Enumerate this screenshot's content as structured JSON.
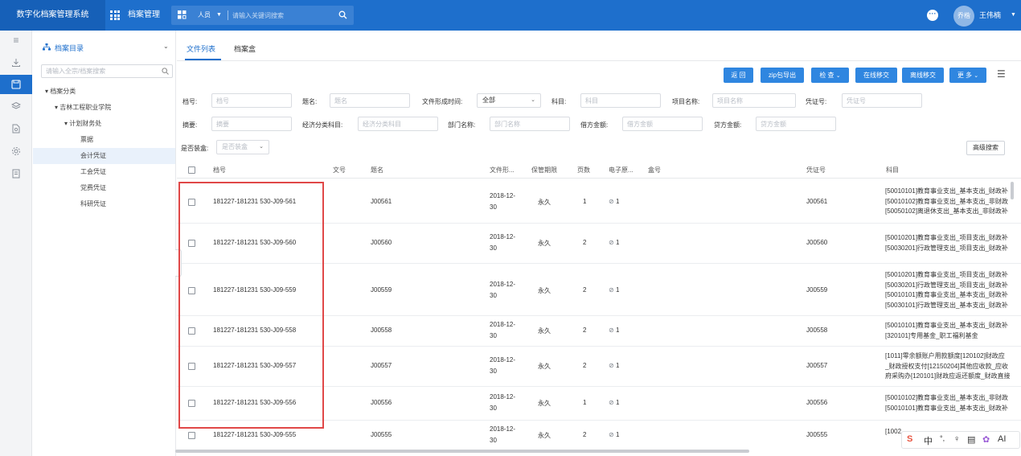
{
  "topbar": {
    "app_title": "数字化档案管理系统",
    "menu_archive": "档案管理",
    "search_scope": "人员",
    "search_placeholder": "请输入关键词搜索",
    "avatar_text": "乔楷",
    "username": "王伟楠"
  },
  "tree": {
    "title": "档案目录",
    "search_placeholder": "请输入全宗/档案搜索",
    "nodes": [
      {
        "label": "档案分类",
        "level": 0
      },
      {
        "label": "吉林工程职业学院",
        "level": 1
      },
      {
        "label": "计划财务处",
        "level": 2
      },
      {
        "label": "票据",
        "level": 3
      },
      {
        "label": "会计凭证",
        "level": 3,
        "selected": true
      },
      {
        "label": "工会凭证",
        "level": 3
      },
      {
        "label": "党费凭证",
        "level": 3
      },
      {
        "label": "科研凭证",
        "level": 3
      }
    ]
  },
  "tabs": [
    "文件列表",
    "档案盒"
  ],
  "toolbar": {
    "return": "返 回",
    "zip_export": "zip包导出",
    "check": "检 查",
    "online_transfer": "在线移交",
    "offline_transfer": "离线移交",
    "more": "更 多"
  },
  "filters": {
    "doc_no": {
      "label": "档号:",
      "placeholder": "档号"
    },
    "title": {
      "label": "题名:",
      "placeholder": "题名"
    },
    "form_time": {
      "label": "文件形成时间:",
      "value": "全部"
    },
    "subject": {
      "label": "科目:",
      "placeholder": "科目"
    },
    "project": {
      "label": "项目名称:",
      "placeholder": "项目名称"
    },
    "voucher": {
      "label": "凭证号:",
      "placeholder": "凭证号"
    },
    "summary": {
      "label": "摘要:",
      "placeholder": "摘要"
    },
    "econ": {
      "label": "经济分类科目:",
      "placeholder": "经济分类科目"
    },
    "dept": {
      "label": "部门名称:",
      "placeholder": "部门名称"
    },
    "debit": {
      "label": "借方金额:",
      "placeholder": "借方金额"
    },
    "credit": {
      "label": "贷方金额:",
      "placeholder": "贷方金额"
    },
    "boxed": {
      "label": "是否装盒:",
      "placeholder": "是否装盒"
    },
    "advanced": "高级搜索"
  },
  "table": {
    "headers": {
      "doc_no": "档号",
      "file_no": "文号",
      "title": "题名",
      "form_date": "文件形...",
      "retention": "保管期限",
      "pages": "页数",
      "electronic": "电子原...",
      "box_no": "盒号",
      "voucher": "凭证号",
      "subject": "科目"
    },
    "rows": [
      {
        "doc_no": "181227-181231 530-J09-561",
        "title": "J00561",
        "date1": "2018-12-",
        "date2": "30",
        "retention": "永久",
        "pages": "1",
        "attach": "1",
        "voucher": "J00561",
        "subject": [
          "[50010101]教育事业支出_基本支出_财政补",
          "[50010102]教育事业支出_基本支出_非财政",
          "[50050102]离退休支出_基本支出_非财政补"
        ]
      },
      {
        "doc_no": "181227-181231 530-J09-560",
        "title": "J00560",
        "date1": "2018-12-",
        "date2": "30",
        "retention": "永久",
        "pages": "2",
        "attach": "1",
        "voucher": "J00560",
        "subject": [
          "[50010201]教育事业支出_项目支出_财政补",
          "[50030201]行政管理支出_项目支出_财政补"
        ]
      },
      {
        "doc_no": "181227-181231 530-J09-559",
        "title": "J00559",
        "date1": "2018-12-",
        "date2": "30",
        "retention": "永久",
        "pages": "2",
        "attach": "1",
        "voucher": "J00559",
        "subject": [
          "[50010201]教育事业支出_项目支出_财政补",
          "[50030201]行政管理支出_项目支出_财政补",
          "[50010101]教育事业支出_基本支出_财政补",
          "[50030101]行政管理支出_基本支出_财政补"
        ]
      },
      {
        "doc_no": "181227-181231 530-J09-558",
        "title": "J00558",
        "date1": "2018-12-",
        "date2": "30",
        "retention": "永久",
        "pages": "2",
        "attach": "1",
        "voucher": "J00558",
        "subject": [
          "[50010101]教育事业支出_基本支出_财政补",
          "[320101]专用基金_职工福利基金"
        ]
      },
      {
        "doc_no": "181227-181231 530-J09-557",
        "title": "J00557",
        "date1": "2018-12-",
        "date2": "30",
        "retention": "永久",
        "pages": "2",
        "attach": "1",
        "voucher": "J00557",
        "subject": [
          "[1011]零余额账户用款额度[120102]财政应",
          "_财政授权支付[12150204]其他应收款_应收",
          "府采购办[120101]财政应返还额度_财政直接"
        ]
      },
      {
        "doc_no": "181227-181231 530-J09-556",
        "title": "J00556",
        "date1": "2018-12-",
        "date2": "30",
        "retention": "永久",
        "pages": "1",
        "attach": "1",
        "voucher": "J00556",
        "subject": [
          "[50010102]教育事业支出_基本支出_非财政",
          "[50010101]教育事业支出_基本支出_财政补"
        ]
      },
      {
        "doc_no": "181227-181231 530-J09-555",
        "title": "J00555",
        "date1": "2018-12-",
        "date2": "30",
        "retention": "永久",
        "pages": "2",
        "attach": "1",
        "voucher": "J00555",
        "subject": [
          "[1002"
        ]
      }
    ]
  },
  "ime": {
    "logo": "S",
    "mode": "中",
    "punct": "°,",
    "mic": "♀",
    "keyboard": "▤",
    "skin": "✿",
    "ai": "AI"
  }
}
